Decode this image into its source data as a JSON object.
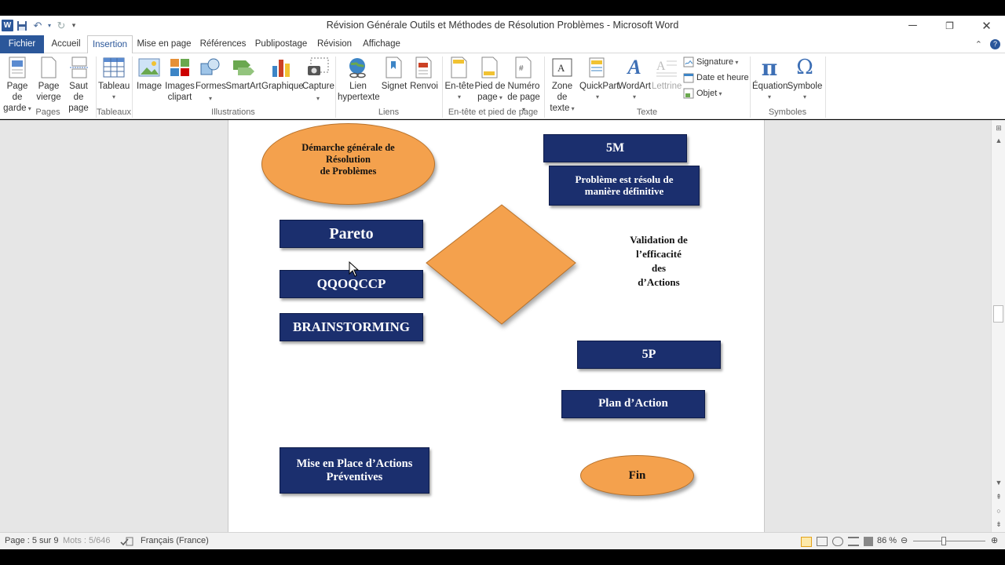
{
  "window": {
    "title": "Révision Générale Outils et Méthodes de Résolution Problèmes - Microsoft Word",
    "logo": "W"
  },
  "tabs": [
    "Fichier",
    "Accueil",
    "Insertion",
    "Mise en page",
    "Références",
    "Publipostage",
    "Révision",
    "Affichage"
  ],
  "active_tab": "Insertion",
  "ribbon": {
    "pages": {
      "label": "Pages",
      "page_de_garde": [
        "Page de",
        "garde"
      ],
      "page_vierge": [
        "Page",
        "vierge"
      ],
      "saut_de_page": [
        "Saut de",
        "page"
      ]
    },
    "tableaux": {
      "label": "Tableaux",
      "tableau": "Tableau"
    },
    "illustrations": {
      "label": "Illustrations",
      "image": "Image",
      "images_clipart": [
        "Images",
        "clipart"
      ],
      "formes": "Formes",
      "smartart": "SmartArt",
      "graphique": "Graphique",
      "capture": "Capture"
    },
    "liens": {
      "label": "Liens",
      "lien_hypertexte": [
        "Lien",
        "hypertexte"
      ],
      "signet": "Signet",
      "renvoi": "Renvoi"
    },
    "entete": {
      "label": "En-tête et pied de page",
      "en_tete": "En-tête",
      "pied_de_page": [
        "Pied de",
        "page"
      ],
      "numero_de_page": [
        "Numéro",
        "de page"
      ]
    },
    "texte": {
      "label": "Texte",
      "zone_de_texte": [
        "Zone de",
        "texte"
      ],
      "quickpart": "QuickPart",
      "wordart": "WordArt",
      "lettrine": "Lettrine",
      "signature": "Signature",
      "date_et_heure": "Date et heure",
      "objet": "Objet"
    },
    "symboles": {
      "label": "Symboles",
      "equation": "Équation",
      "symbole": "Symbole"
    }
  },
  "document": {
    "shapes": {
      "demarche": [
        "Démarche générale de",
        "Résolution",
        "de Problèmes"
      ],
      "pareto": "Pareto",
      "qqoqccp": "QQOQCCP",
      "brainstorming": "BRAINSTORMING",
      "mise_en_place": [
        "Mise en Place d’Actions",
        "Préventives"
      ],
      "five_m": "5M",
      "probleme_resolu": [
        "Problème est résolu de",
        "manière définitive"
      ],
      "validation": [
        "Validation de",
        "l’efficacité",
        "des",
        "d’Actions"
      ],
      "five_p": "5P",
      "plan_action": "Plan d’Action",
      "fin": "Fin"
    },
    "colors": {
      "navy_box": "#1b2f6e",
      "orange_shape": "#f4a14d"
    }
  },
  "status": {
    "page": "Page : 5 sur 9",
    "words": "Mots : 5/646",
    "language": "Français (France)",
    "zoom": "86 %",
    "zoom_level_percent": 86
  }
}
